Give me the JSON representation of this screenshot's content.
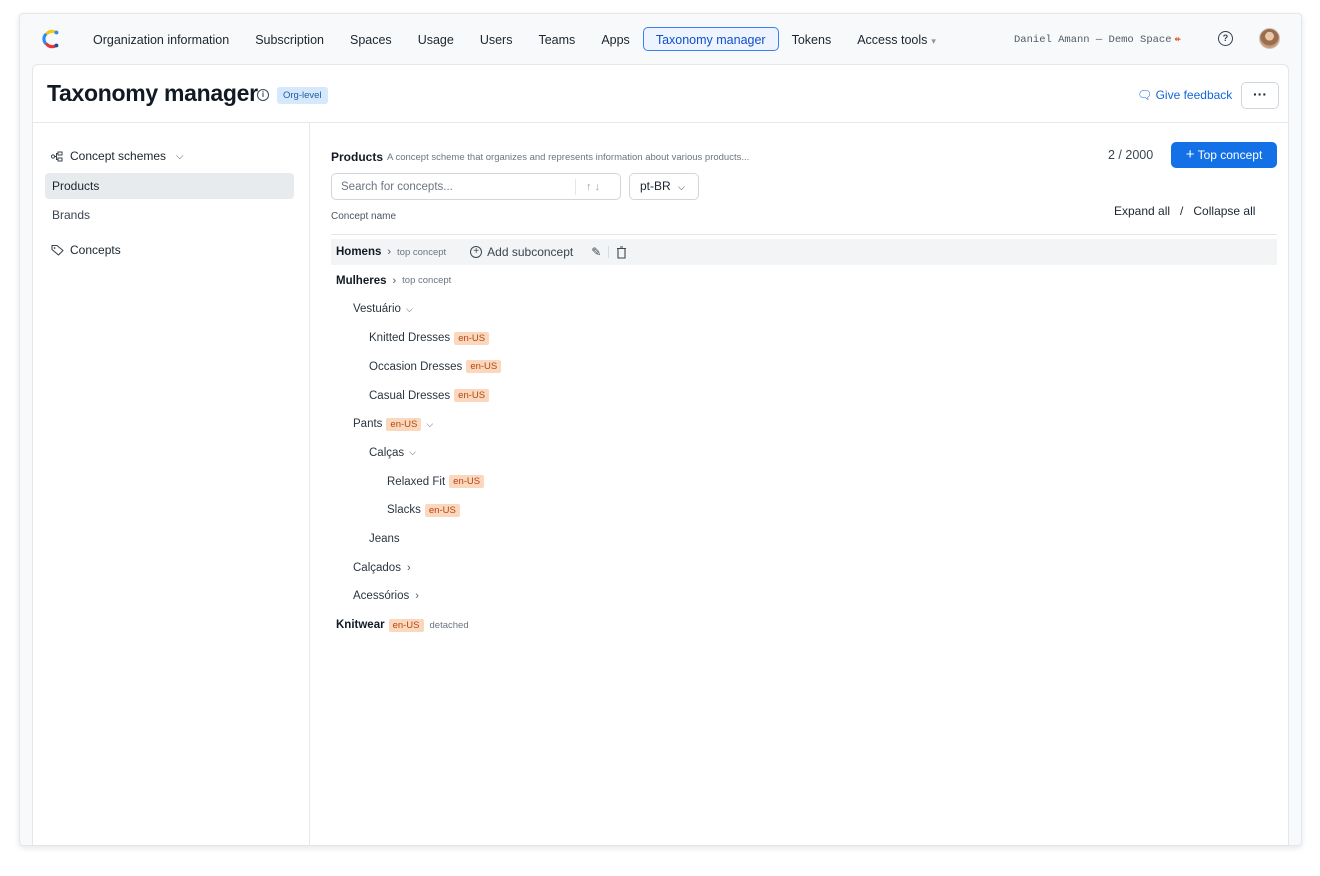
{
  "nav": {
    "items": [
      {
        "label": "Organization information"
      },
      {
        "label": "Subscription"
      },
      {
        "label": "Spaces"
      },
      {
        "label": "Usage"
      },
      {
        "label": "Users"
      },
      {
        "label": "Teams"
      },
      {
        "label": "Apps"
      },
      {
        "label": "Taxonomy manager",
        "active": true
      },
      {
        "label": "Tokens"
      },
      {
        "label": "Access tools"
      }
    ],
    "space_label": "Daniel Amann — Demo Space"
  },
  "header": {
    "title": "Taxonomy manager",
    "badge": "Org-level",
    "feedback_label": "Give feedback",
    "more_label": "···"
  },
  "sidebar": {
    "schemes_label": "Concept schemes",
    "schemes": [
      {
        "label": "Products",
        "selected": true
      },
      {
        "label": "Brands"
      }
    ],
    "concepts_label": "Concepts"
  },
  "content": {
    "scheme_name": "Products",
    "scheme_description": "A concept scheme that organizes and represents information about various products...",
    "count": "2 / 2000",
    "top_concept_button": "Top concept",
    "search_placeholder": "Search for concepts...",
    "search_arrows": "↑ ↓",
    "language": "pt-BR",
    "column_header": "Concept name",
    "expand_all": "Expand all",
    "separator": "/",
    "collapse_all": "Collapse all",
    "add_subconcept": "Add subconcept",
    "tree": [
      {
        "name": "Homens",
        "bold": true,
        "meta": "top concept",
        "chevron": "right",
        "highlighted": true,
        "actions": true,
        "level": 0
      },
      {
        "name": "Mulheres",
        "bold": true,
        "meta": "top concept",
        "chevron": "right",
        "level": 0
      },
      {
        "name": "Vestuário",
        "chevron": "down",
        "level": 1
      },
      {
        "name": "Knitted Dresses",
        "tag": "en-US",
        "level": 2
      },
      {
        "name": "Occasion Dresses",
        "tag": "en-US",
        "level": 2
      },
      {
        "name": "Casual Dresses",
        "tag": "en-US",
        "level": 2
      },
      {
        "name": "Pants",
        "tag": "en-US",
        "chevron": "down",
        "level": 1
      },
      {
        "name": "Calças",
        "chevron": "down",
        "level": 2
      },
      {
        "name": "Relaxed Fit",
        "tag": "en-US",
        "level": 3
      },
      {
        "name": "Slacks",
        "tag": "en-US",
        "level": 3
      },
      {
        "name": "Jeans",
        "level": 2
      },
      {
        "name": "Calçados",
        "chevron": "right",
        "level": 1
      },
      {
        "name": "Acessórios",
        "chevron": "right",
        "level": 1
      },
      {
        "name": "Knitwear",
        "bold": true,
        "tag": "en-US",
        "meta": "detached",
        "level": 0
      }
    ]
  },
  "colors": {
    "accent": "#1370e6",
    "tag_bg": "#fbd8bd",
    "tag_text": "#b4450f",
    "badge_bg": "#d6e8fb"
  }
}
